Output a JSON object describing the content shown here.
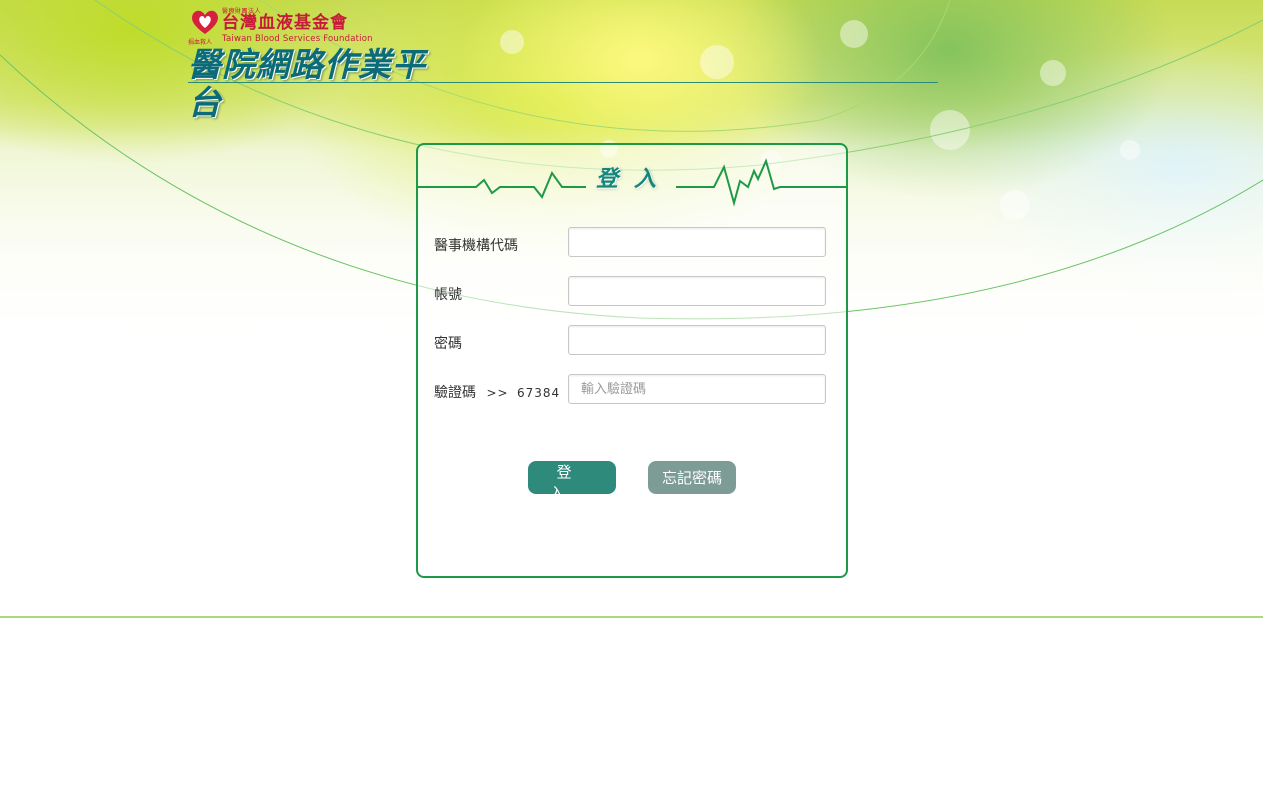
{
  "header": {
    "org_small_top": "醫療財團法人",
    "org_small_left": "捐血救人",
    "org_name_cn": "台灣血液基金會",
    "org_name_en": "Taiwan Blood Services Foundation",
    "platform_title": "醫院網路作業平台"
  },
  "login": {
    "heading": "登入",
    "fields": [
      {
        "label": "醫事機構代碼",
        "value": "",
        "placeholder": ""
      },
      {
        "label": "帳號",
        "value": "",
        "placeholder": ""
      },
      {
        "label": "密碼",
        "value": "",
        "placeholder": ""
      },
      {
        "label": "驗證碼",
        "value": "",
        "placeholder": "輸入驗證碼"
      }
    ],
    "captcha_prefix": ">>",
    "captcha_code": "67384",
    "login_button": "登入",
    "forgot_button": "忘記密碼"
  },
  "colors": {
    "frame_green": "#1e9a47",
    "login_button_bg": "#2e8a7a",
    "forgot_button_bg": "#7e9c96",
    "title_teal": "#0b6b78",
    "brand_red": "#c81a3a",
    "footer_line": "#a9d97c"
  },
  "icons": {
    "logo": "blood-heart-logo-icon",
    "pulse": "heartbeat-line-icon"
  }
}
